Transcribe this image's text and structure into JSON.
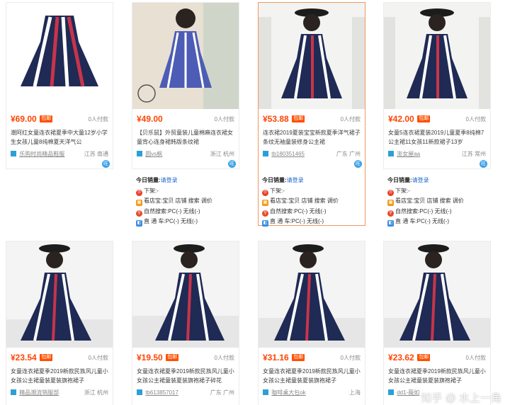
{
  "products": [
    {
      "price": "¥69.00",
      "baoyou": "包邮",
      "paid": "0人付款",
      "title": "潮阿红女童连衣裙夏季中大童12岁小学生女孩儿童8纯棉夏天洋气公",
      "shop": "乐购时尚精品鞋服",
      "location": "江苏 南通",
      "wang": "旺",
      "stats": null
    },
    {
      "price": "¥49.00",
      "baoyou": "",
      "paid": "0人付款",
      "title": "【贝乐鼠】外贸童装儿童棉麻连衣裙女童背心连身裙韩版条纹裙",
      "shop": "圆vs枫",
      "location": "浙江 杭州",
      "wang": "旺",
      "stats": {
        "label": "今日销量:",
        "login": "请登录",
        "xiajia": "下架:-",
        "kan": "看店宝:宝贝 店铺 搜索 调价",
        "ziran": "自然搜索:PC(-) 无线(-)",
        "zhitong": "直 通 车:PC(-) 无线(-)"
      }
    },
    {
      "price": "¥53.88",
      "baoyou": "包邮",
      "paid": "0人付款",
      "title": "连衣裙2019夏装宝宝新款夏季洋气裙子条纹无袖童装修身公主裙",
      "shop": "tb180351465",
      "location": "广东 广州",
      "wang": "旺",
      "stats": {
        "label": "今日销量:",
        "login": "请登录",
        "xiajia": "下架:-",
        "kan": "看店宝:宝贝 店铺 搜索 调价",
        "ziran": "自然搜索:PC(-) 无线(-)",
        "zhitong": "直 通 车:PC(-) 无线(-)"
      }
    },
    {
      "price": "¥42.00",
      "baoyou": "包邮",
      "paid": "0人付款",
      "title": "女童5连衣裙夏装2019儿童夏季8纯棉7公主裙11女孩11新款裙子13岁",
      "shop": "澎女屋aa",
      "location": "江苏 常州",
      "wang": "旺",
      "stats": {
        "label": "今日销量:",
        "login": "请登录",
        "xiajia": "下架:-",
        "kan": "看店宝:宝贝 店铺 搜索 调价",
        "ziran": "自然搜索:PC(-) 无线(-)",
        "zhitong": "直 通 车:PC(-) 无线(-)"
      }
    },
    {
      "price": "¥23.54",
      "baoyou": "包邮",
      "paid": "0人付款",
      "title": "女童连衣裙夏季2019新款民族风儿童小女孩公主裙童装夏装旗袍裙子",
      "shop": "精品潮流销服部",
      "location": "浙江 杭州",
      "wang": "",
      "stats": null
    },
    {
      "price": "¥19.50",
      "baoyou": "包邮",
      "paid": "0人付款",
      "title": "女童连衣裙夏季2019新款民族风儿童小女孩公主裙童装夏装旗袍裙子碎花",
      "shop": "tb613857017",
      "location": "广东 广州",
      "wang": "",
      "stats": null
    },
    {
      "price": "¥31.16",
      "baoyou": "包邮",
      "paid": "0人付款",
      "title": "女童连衣裙夏季2019新款民族风儿童小女孩公主裙童装夏装旗袍裙子",
      "shop": "咖啡桌大包ok",
      "location": "上海",
      "wang": "",
      "stats": null
    },
    {
      "price": "¥23.62",
      "baoyou": "包邮",
      "paid": "0人付款",
      "title": "女童连衣裙夏季2019新款民族风儿童小女孩公主裙童装夏装旗袍裙子",
      "shop": "dd1-薇如",
      "location": "",
      "wang": "",
      "stats": null
    }
  ],
  "watermark": "知乎 @ 水上一角",
  "colors": {
    "price": "#ff4400",
    "baoyou": "#ff5000",
    "active_border": "#f09860",
    "link": "#1a66c8",
    "wang": "#3aa0e8"
  }
}
